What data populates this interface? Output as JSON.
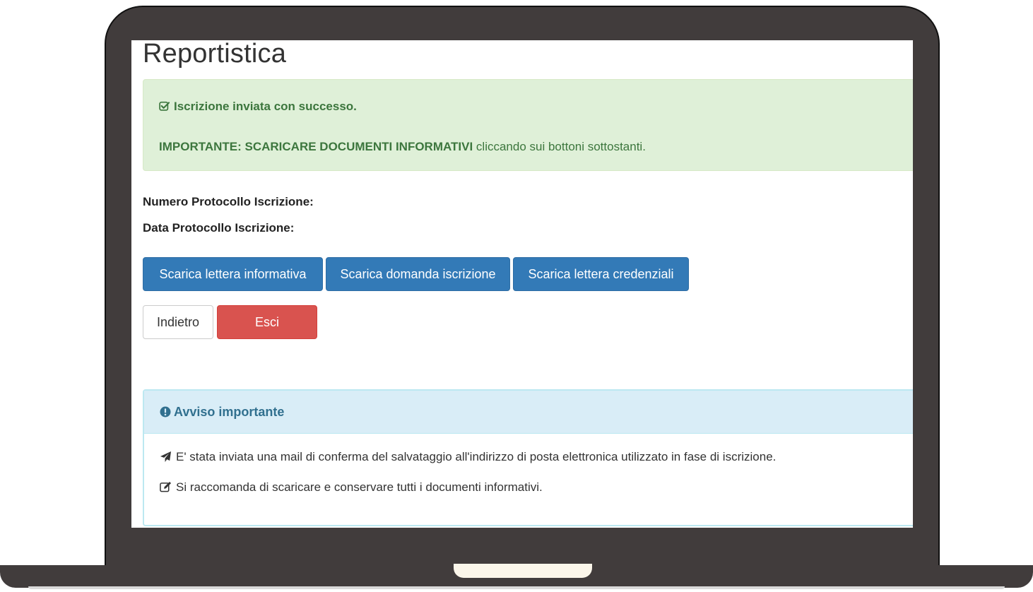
{
  "page": {
    "title": "Reportistica"
  },
  "alert_success": {
    "icon": "check-square-icon",
    "message": "Iscrizione inviata con successo.",
    "important_bold": "IMPORTANTE: SCARICARE DOCUMENTI INFORMATIVI",
    "important_rest": " cliccando sui bottoni sottostanti.",
    "color": "#3c763d",
    "background": "#dff0d8"
  },
  "protocol": {
    "number_label": "Numero Protocollo Iscrizione:",
    "date_label": "Data Protocollo Iscrizione:"
  },
  "download_buttons": [
    {
      "label": "Scarica lettera informativa"
    },
    {
      "label": "Scarica domanda iscrizione"
    },
    {
      "label": "Scarica lettera credenziali"
    }
  ],
  "nav_buttons": {
    "back_label": "Indietro",
    "exit_label": "Esci"
  },
  "notice": {
    "icon": "exclamation-circle-icon",
    "heading": "Avviso importante",
    "lines": [
      {
        "icon": "paper-plane-icon",
        "text": "E' stata inviata una mail di conferma del salvataggio all'indirizzo di posta elettronica utilizzato in fase di iscrizione."
      },
      {
        "icon": "edit-icon",
        "text": "Si raccomanda di scaricare e conservare tutti i documenti informativi."
      }
    ]
  },
  "colors": {
    "primary": "#337ab7",
    "danger": "#d9534f",
    "info_heading": "#31708f",
    "laptop_frame": "#413c3c"
  }
}
